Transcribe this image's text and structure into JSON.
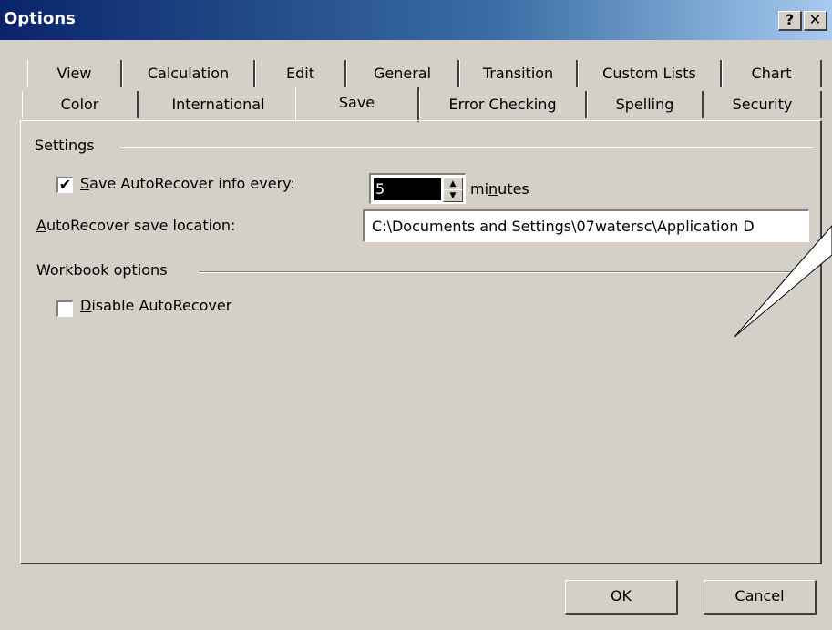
{
  "window": {
    "title": "Options",
    "help_glyph": "?",
    "close_glyph": "✕"
  },
  "tabs_row1": [
    "View",
    "Calculation",
    "Edit",
    "General",
    "Transition",
    "Custom Lists",
    "Chart"
  ],
  "tabs_row2": [
    "Color",
    "International",
    "Save",
    "Error Checking",
    "Spelling",
    "Security"
  ],
  "active_tab": "Save",
  "settings": {
    "group_label": "Settings",
    "autorecover_every": {
      "label": "Save AutoRecover info every:",
      "checked": true,
      "check_glyph": "✔"
    },
    "minutes_value": "5",
    "minutes_label": "minutes",
    "location_label": "AutoRecover save location:",
    "location_value": "C:\\Documents and Settings\\07watersc\\Application D"
  },
  "workbook": {
    "group_label": "Workbook options",
    "disable_autorecover": {
      "label": "Disable AutoRecover",
      "checked": false
    }
  },
  "buttons": {
    "ok": "OK",
    "cancel": "Cancel"
  },
  "colors": {
    "face": "#d4d0c8",
    "title_start": "#0a246a",
    "title_end": "#a6caf0"
  }
}
